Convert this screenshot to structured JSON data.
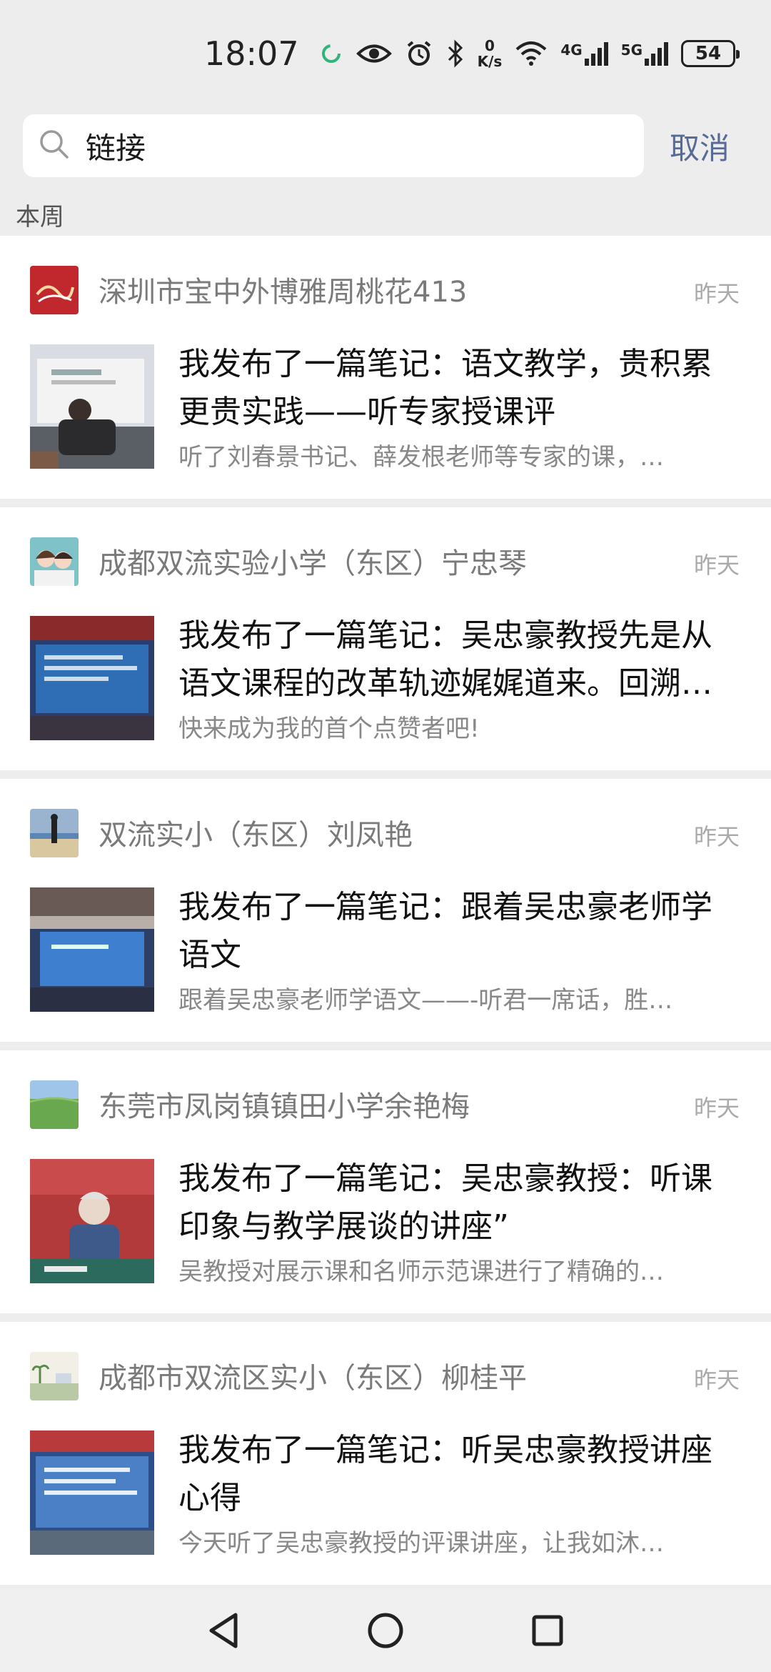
{
  "status_bar": {
    "time": "18:07",
    "speed_value": "0",
    "speed_unit": "K/s",
    "net1": "4G",
    "net2": "5G",
    "battery": "54",
    "icons": [
      "sync-icon",
      "eye-icon",
      "alarm-icon",
      "bluetooth-icon",
      "wifi-icon",
      "signal-icon",
      "battery-icon"
    ]
  },
  "search": {
    "value": "链接",
    "cancel_label": "取消"
  },
  "section_label": "本周",
  "posts": [
    {
      "author": "深圳市宝中外博雅周桃花413",
      "date": "昨天",
      "title": "我发布了一篇笔记：语文教学，贵积累更贵实践——听专家授课评",
      "desc": "听了刘春景书记、薛发根老师等专家的课，…",
      "avatar_color": "#c0282d",
      "thumb_color": "#8a8f9a"
    },
    {
      "author": "成都双流实验小学（东区）宁忠琴",
      "date": "昨天",
      "title": "我发布了一篇笔记：吴忠豪教授先是从语文课程的改革轨迹娓娓道来。回溯…",
      "desc": "快来成为我的首个点赞者吧!",
      "avatar_color": "#7fc3c8",
      "thumb_color": "#2a5a9a"
    },
    {
      "author": "双流实小（东区）刘凤艳",
      "date": "昨天",
      "title": "我发布了一篇笔记：跟着吴忠豪老师学语文",
      "desc": "跟着吴忠豪老师学语文——-听君一席话，胜…",
      "avatar_color": "#9ab3cf",
      "thumb_color": "#3a5f9e"
    },
    {
      "author": "东莞市凤岗镇镇田小学余艳梅",
      "date": "昨天",
      "title": "我发布了一篇笔记：吴忠豪教授：听课印象与教学展谈的讲座”",
      "desc": "吴教授对展示课和名师示范课进行了精确的…",
      "avatar_color": "#6aa84f",
      "thumb_color": "#b23a3a"
    },
    {
      "author": "成都市双流区实小（东区）柳桂平",
      "date": "昨天",
      "title": "我发布了一篇笔记：听吴忠豪教授讲座心得",
      "desc": "今天听了吴忠豪教授的评课讲座，让我如沐…",
      "avatar_color": "#b9c9a5",
      "thumb_color": "#3d6aa8"
    }
  ]
}
